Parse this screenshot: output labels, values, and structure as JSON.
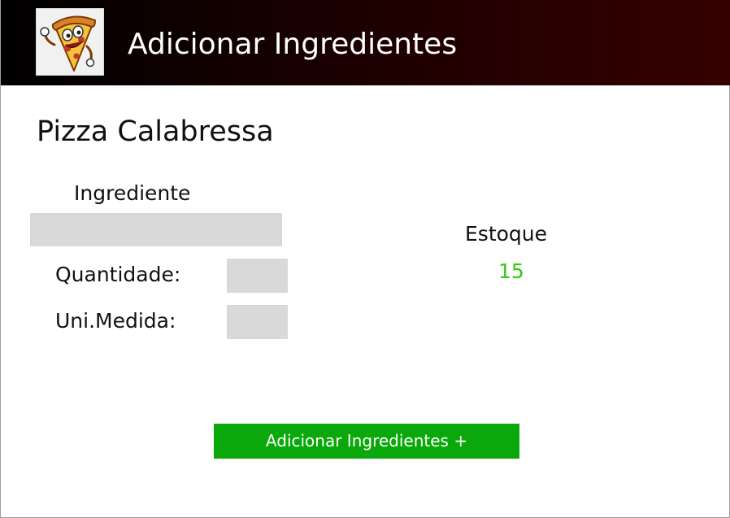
{
  "header": {
    "title": "Adicionar Ingredientes",
    "logo_icon": "pizza-mascot-icon",
    "background_start": "#000000",
    "background_end": "#350000"
  },
  "form": {
    "pizza_name": "Pizza Calabressa",
    "ingredient_label": "Ingrediente",
    "ingredient_value": "",
    "quantity_label": "Quantidade:",
    "quantity_value": "",
    "unit_label": "Uni.Medida:",
    "unit_value": ""
  },
  "stock": {
    "label": "Estoque",
    "value": "15",
    "value_color": "#2ecc0e"
  },
  "actions": {
    "add_label": "Adicionar Ingredientes +",
    "add_color": "#0aa80a"
  }
}
